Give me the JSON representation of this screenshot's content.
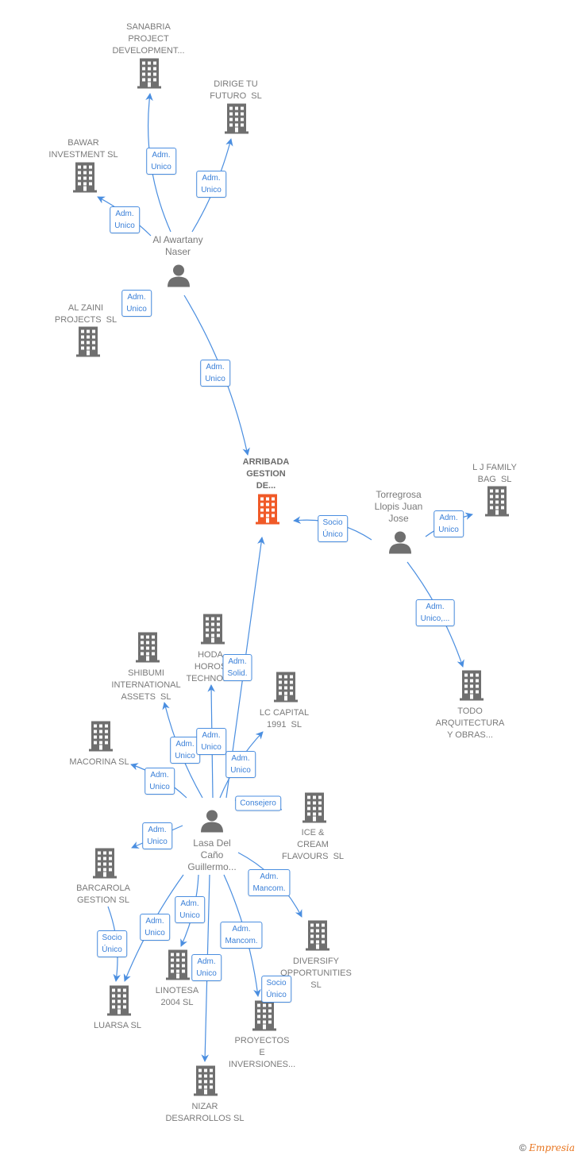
{
  "colors": {
    "building": "#6f6f6f",
    "main_building": "#f05a28",
    "edge": "#4a8ee0",
    "label": "#7a7a7a"
  },
  "nodes": [
    {
      "label": "SANABRIA\nPROJECT\nDEVELOPMENT...",
      "type": "company"
    },
    {
      "label": "DIRIGE TU\nFUTURO  SL",
      "type": "company"
    },
    {
      "label": "BAWAR\nINVESTMENT SL",
      "type": "company"
    },
    {
      "label": "Al Awartany\nNaser",
      "type": "person"
    },
    {
      "label": "AL ZAINI\nPROJECTS  SL",
      "type": "company"
    },
    {
      "label": "ARRIBADA\nGESTION\nDE...",
      "type": "main"
    },
    {
      "label": "Torregrosa\nLlopis Juan\nJose",
      "type": "person"
    },
    {
      "label": "L J FAMILY\nBAG  SL",
      "type": "company"
    },
    {
      "label": "TODO\nARQUITECTURA\nY OBRAS...",
      "type": "company"
    },
    {
      "label": "SHIBUMI\nINTERNATIONAL\nASSETS  SL",
      "type": "company"
    },
    {
      "label": "HODA\nHOROS\nTECHNOLO",
      "type": "company"
    },
    {
      "label": "LC CAPITAL\n1991  SL",
      "type": "company"
    },
    {
      "label": "MACORINA SL",
      "type": "company"
    },
    {
      "label": "Lasa Del\nCaño\nGuillermo...",
      "type": "person"
    },
    {
      "label": "ICE &\nCREAM\nFLAVOURS  SL",
      "type": "company"
    },
    {
      "label": "BARCAROLA\nGESTION SL",
      "type": "company"
    },
    {
      "label": "DIVERSIFY\nOPPORTUNITIES\nSL",
      "type": "company"
    },
    {
      "label": "LINOTESA\n2004 SL",
      "type": "company"
    },
    {
      "label": "LUARSA SL",
      "type": "company"
    },
    {
      "label": "PROYECTOS\nE\nINVERSIONES...",
      "type": "company"
    },
    {
      "label": "NIZAR\nDESARROLLOS SL",
      "type": "company"
    }
  ],
  "edges": [
    {
      "from": 3,
      "to": 0,
      "label": "Adm.\nUnico"
    },
    {
      "from": 3,
      "to": 1,
      "label": "Adm.\nUnico"
    },
    {
      "from": 3,
      "to": 2,
      "label": "Adm.\nUnico"
    },
    {
      "from": 3,
      "to": 4,
      "label": "Adm.\nUnico"
    },
    {
      "from": 3,
      "to": 5,
      "label": "Adm.\nUnico"
    },
    {
      "from": 6,
      "to": 5,
      "label": "Socio\nÚnico"
    },
    {
      "from": 6,
      "to": 7,
      "label": "Adm.\nUnico"
    },
    {
      "from": 6,
      "to": 8,
      "label": "Adm.\nUnico,..."
    },
    {
      "from": 13,
      "to": 5,
      "label": "Adm.\nSolid."
    },
    {
      "from": 13,
      "to": 9,
      "label": "Adm.\nUnico"
    },
    {
      "from": 13,
      "to": 10,
      "label": "Adm.\nUnico"
    },
    {
      "from": 13,
      "to": 11,
      "label": "Adm.\nUnico"
    },
    {
      "from": 13,
      "to": 12,
      "label": "Adm.\nUnico"
    },
    {
      "from": 13,
      "to": 14,
      "label": "Consejero"
    },
    {
      "from": 13,
      "to": 15,
      "label": "Adm.\nUnico"
    },
    {
      "from": 13,
      "to": 16,
      "label": "Adm.\nMancom."
    },
    {
      "from": 13,
      "to": 17,
      "label": "Adm.\nUnico"
    },
    {
      "from": 13,
      "to": 18,
      "label": "Adm.\nUnico"
    },
    {
      "from": 13,
      "to": 19,
      "label": "Adm.\nMancom."
    },
    {
      "from": 13,
      "to": 20,
      "label": "Adm.\nUnico"
    },
    {
      "from": 15,
      "to": 18,
      "label": "Socio\nÚnico"
    },
    {
      "from": 16,
      "to": 19,
      "label": "Socio\nÚnico"
    }
  ],
  "footer": {
    "copyright": "©",
    "brand": "Empresia"
  }
}
